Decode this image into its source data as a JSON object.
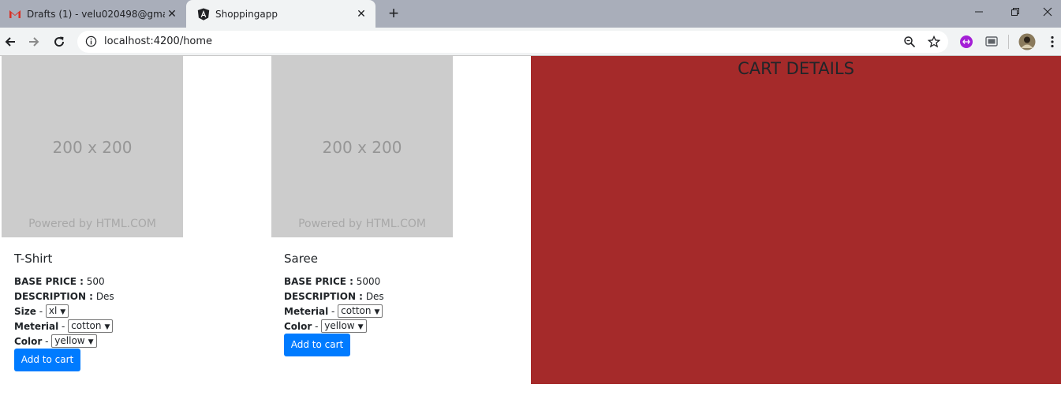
{
  "browser": {
    "tabs": [
      {
        "title": "Drafts (1) - velu020498@gmail.com",
        "favicon": "gmail-icon",
        "active": false
      },
      {
        "title": "Shoppingapp",
        "favicon": "angular-icon",
        "active": true
      }
    ],
    "url": "localhost:4200/home"
  },
  "products": [
    {
      "image_dim": "200 x 200",
      "image_powered": "Powered by HTML.COM",
      "name": "T-Shirt",
      "base_price_label": "BASE PRICE :",
      "base_price": "500",
      "description_label": "DESCRIPTION :",
      "description": "Des",
      "size_label": "Size",
      "size_value": "xl",
      "material_label": "Meterial",
      "material_value": "cotton",
      "color_label": "Color",
      "color_value": "yellow",
      "button_label": "Add to cart"
    },
    {
      "image_dim": "200 x 200",
      "image_powered": "Powered by HTML.COM",
      "name": "Saree",
      "base_price_label": "BASE PRICE :",
      "base_price": "5000",
      "description_label": "DESCRIPTION :",
      "description": "Des",
      "material_label": "Meterial",
      "material_value": "cotton",
      "color_label": "Color",
      "color_value": "yellow",
      "button_label": "Add to cart"
    }
  ],
  "cart": {
    "title": "CART DETAILS",
    "background": "#a52a2a"
  },
  "colors": {
    "button": "#007bff",
    "placeholder": "#cccccc"
  }
}
